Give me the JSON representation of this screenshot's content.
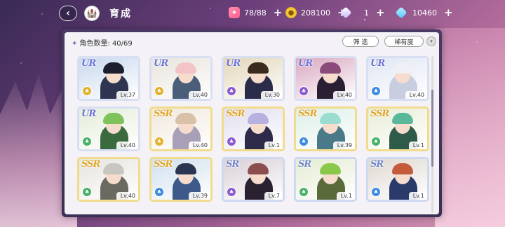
{
  "header": {
    "title": "育成",
    "back_glyph": "‹",
    "home_glyph": "🏰"
  },
  "resources": [
    {
      "name": "candy",
      "icon": "candy-icon",
      "value": "78/88",
      "plus": "+"
    },
    {
      "name": "coin",
      "icon": "coin-icon",
      "value": "208100",
      "plus": "+"
    },
    {
      "name": "gem",
      "icon": "gem-icon",
      "value": "1",
      "plus": "+"
    },
    {
      "name": "diamond",
      "icon": "diamond-icon",
      "value": "10460",
      "plus": "+"
    }
  ],
  "panel": {
    "count_label": "角色数量: 40/69",
    "filter_label": "筛 选",
    "rarity_label": "稀有度",
    "sort_glyph": "▾"
  },
  "cards": [
    {
      "rarity": "UR",
      "level": "Lv.37",
      "attr": "yellow",
      "hair": "#1d1f2e",
      "outfit": "#2f3550",
      "bg": "#c9d9ee"
    },
    {
      "rarity": "UR",
      "level": "Lv.40",
      "attr": "yellow",
      "hair": "#f2c4c8",
      "outfit": "#4a5e7a",
      "bg": "#e8e3dc"
    },
    {
      "rarity": "UR",
      "level": "Lv.30",
      "attr": "purple",
      "hair": "#3b2a1f",
      "outfit": "#2b2c4a",
      "bg": "#e2d6b8"
    },
    {
      "rarity": "UR",
      "level": "Lv.40",
      "attr": "purple",
      "hair": "#8a4a7a",
      "outfit": "#2a1f33",
      "bg": "#d9a8bf"
    },
    {
      "rarity": "UR",
      "level": "Lv.40",
      "attr": "blue",
      "hair": "#eef0f6",
      "outfit": "#c9cde0",
      "bg": "#dfe6f3"
    },
    {
      "rarity": "UR",
      "level": "Lv.40",
      "attr": "green",
      "hair": "#7dc25a",
      "outfit": "#3a6a3e",
      "bg": "#e4edd9"
    },
    {
      "rarity": "SSR",
      "level": "Lv.40",
      "attr": "yellow",
      "hair": "#d9c0a8",
      "outfit": "#a8a0b8",
      "bg": "#f0e8dc"
    },
    {
      "rarity": "SSR",
      "level": "Lv.1",
      "attr": "purple",
      "hair": "#b8b0e0",
      "outfit": "#2e2a4a",
      "bg": "#e2deef"
    },
    {
      "rarity": "SSR",
      "level": "Lv.39",
      "attr": "blue",
      "hair": "#9adcd0",
      "outfit": "#4a7a8a",
      "bg": "#dcefe8"
    },
    {
      "rarity": "SSR",
      "level": "Lv.1",
      "attr": "green",
      "hair": "#5ab89a",
      "outfit": "#2e5a4a",
      "bg": "#e8edd6"
    },
    {
      "rarity": "SSR",
      "level": "Lv.40",
      "attr": "green",
      "hair": "#c8c6c0",
      "outfit": "#6a6a62",
      "bg": "#e6e4de"
    },
    {
      "rarity": "SSR",
      "level": "Lv.39",
      "attr": "blue",
      "hair": "#2a3552",
      "outfit": "#3e5a8a",
      "bg": "#cfe0ee"
    },
    {
      "rarity": "SR",
      "level": "Lv.7",
      "attr": "purple",
      "hair": "#8a4e4e",
      "outfit": "#2a2230",
      "bg": "#d8cfd6"
    },
    {
      "rarity": "SR",
      "level": "Lv.1",
      "attr": "green",
      "hair": "#8ac84a",
      "outfit": "#5a6a3a",
      "bg": "#e4ecd2"
    },
    {
      "rarity": "SR",
      "level": "Lv.1",
      "attr": "blue",
      "hair": "#c45a3a",
      "outfit": "#2a3a6a",
      "bg": "#dfd8d0"
    }
  ]
}
